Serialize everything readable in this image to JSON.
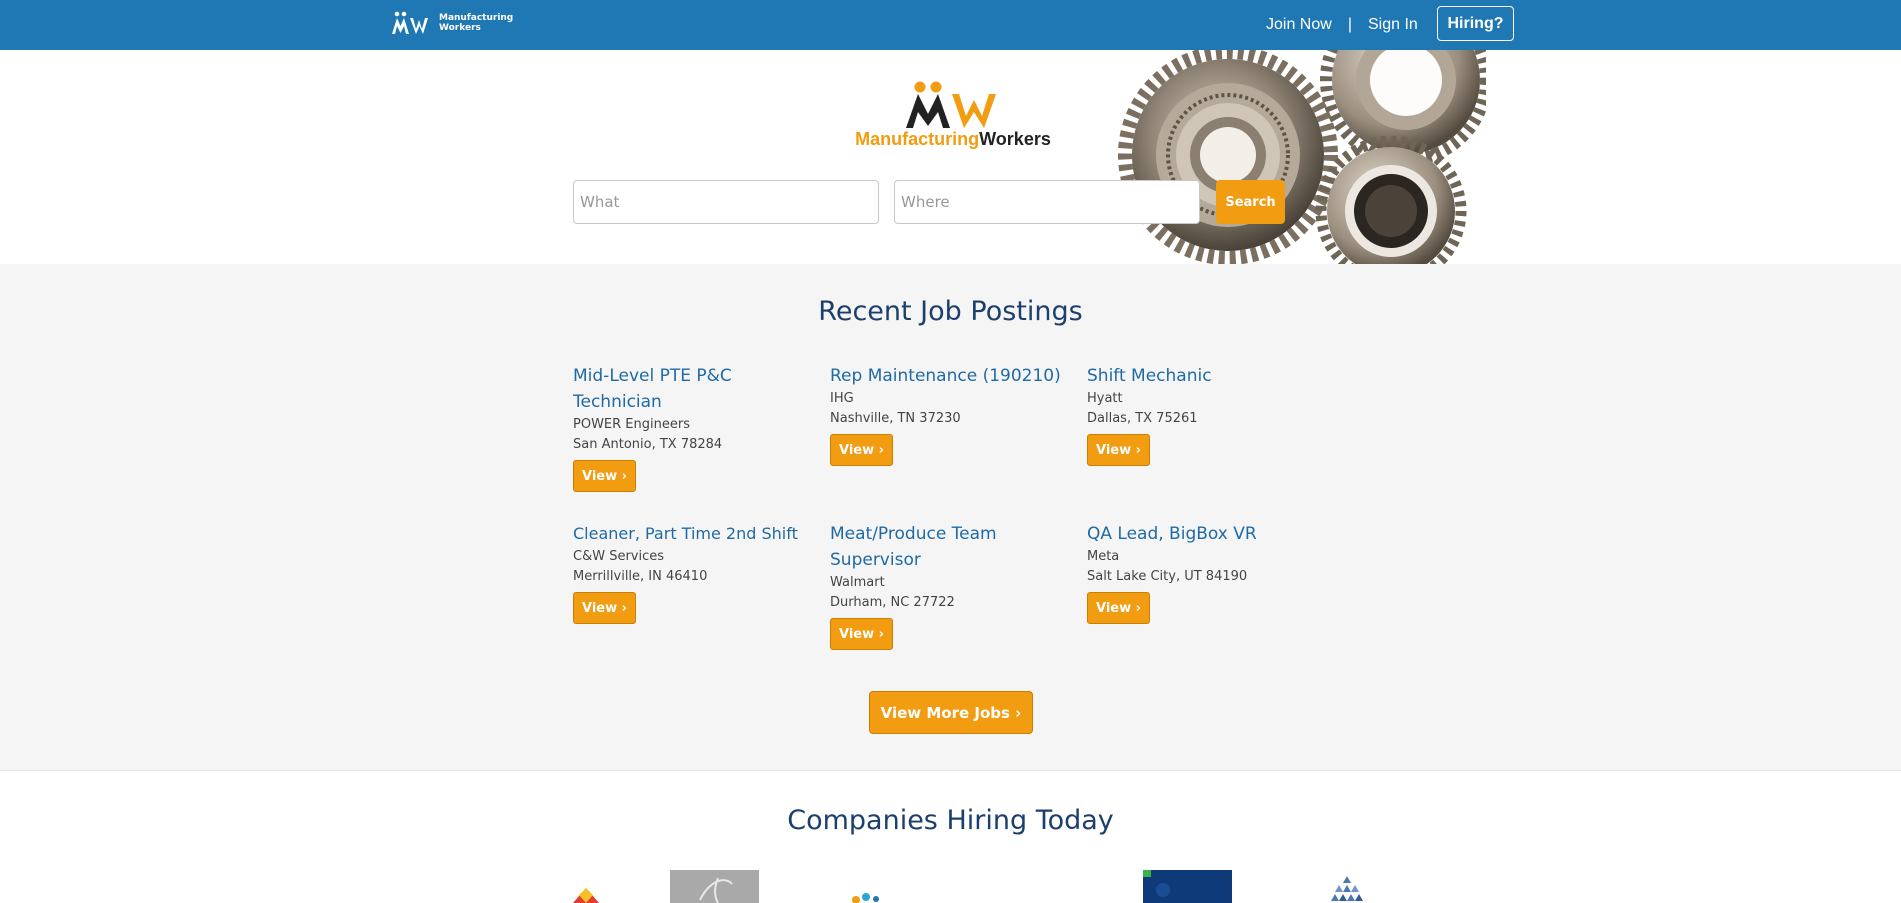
{
  "nav": {
    "logo_text_line1": "Manufacturing",
    "logo_text_line2": "Workers",
    "join_now": "Join Now",
    "separator": "|",
    "sign_in": "Sign In",
    "hiring": "Hiring?"
  },
  "hero": {
    "logo_word1": "Manufacturing",
    "logo_word2": "Workers",
    "what_placeholder": "What",
    "where_placeholder": "Where",
    "search_label": "Search"
  },
  "jobs": {
    "title": "Recent Job Postings",
    "items": [
      {
        "title": "Mid-Level PTE P&C Technician",
        "company": "POWER Engineers",
        "location": "San Antonio, TX 78284",
        "button": "View ›"
      },
      {
        "title": "Rep Maintenance (190210)",
        "company": "IHG",
        "location": "Nashville, TN 37230",
        "button": "View ›"
      },
      {
        "title": "Shift Mechanic",
        "company": "Hyatt",
        "location": "Dallas, TX 75261",
        "button": "View ›"
      },
      {
        "title": "Cleaner, Part Time 2nd Shift",
        "company": "C&W Services",
        "location": "Merrillville, IN 46410",
        "button": "View ›"
      },
      {
        "title": "Meat/Produce Team Supervisor",
        "company": "Walmart",
        "location": "Durham, NC 27722",
        "button": "View ›"
      },
      {
        "title": "QA Lead, BigBox VR",
        "company": "Meta",
        "location": "Salt Lake City, UT 84190",
        "button": "View ›"
      }
    ],
    "more_label": "View More Jobs ›"
  },
  "companies": {
    "title": "Companies Hiring Today"
  },
  "colors": {
    "nav_bg": "#1f78b4",
    "accent": "#f29c11",
    "title_blue": "#1c3f6e",
    "link_blue": "#1f6aa5"
  }
}
